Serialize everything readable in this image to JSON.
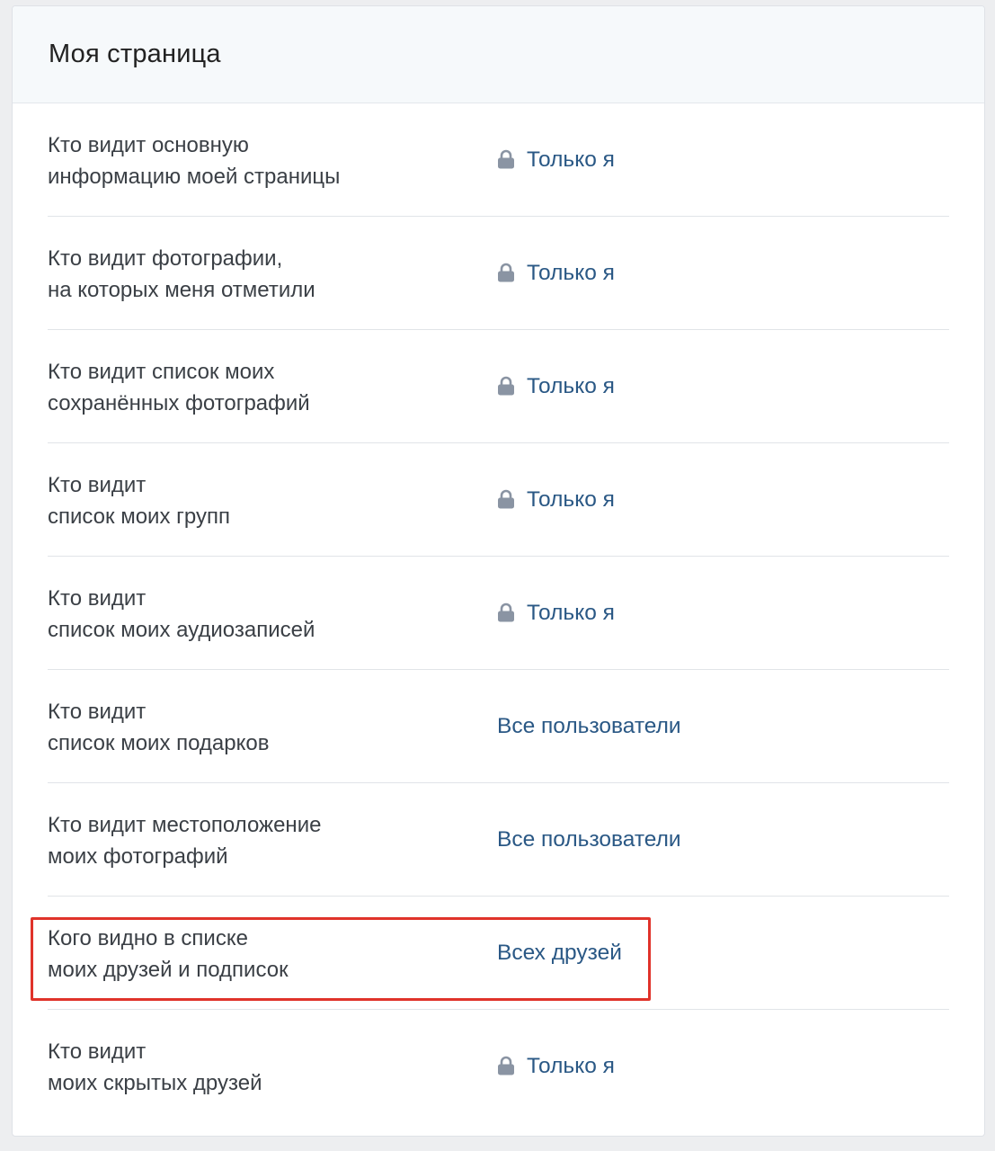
{
  "page": {
    "title": "Моя страница"
  },
  "colors": {
    "link": "#2a5885",
    "label": "#3a3f45",
    "highlight": "#e0332a",
    "lock": "#8a94a3"
  },
  "settings": [
    {
      "label": "Кто видит основную\nинформацию моей страницы",
      "value": "Только я",
      "locked": true
    },
    {
      "label": "Кто видит фотографии,\nна которых меня отметили",
      "value": "Только я",
      "locked": true
    },
    {
      "label": "Кто видит список моих\nсохранённых фотографий",
      "value": "Только я",
      "locked": true
    },
    {
      "label": "Кто видит\nсписок моих групп",
      "value": "Только я",
      "locked": true
    },
    {
      "label": "Кто видит\nсписок моих аудиозаписей",
      "value": "Только я",
      "locked": true
    },
    {
      "label": "Кто видит\nсписок моих подарков",
      "value": "Все пользователи",
      "locked": false
    },
    {
      "label": "Кто видит местоположение\nмоих фотографий",
      "value": "Все пользователи",
      "locked": false
    },
    {
      "label": "Кого видно в списке\nмоих друзей и подписок",
      "value": "Всех друзей",
      "locked": false,
      "highlighted": true
    },
    {
      "label": "Кто видит\nмоих скрытых друзей",
      "value": "Только я",
      "locked": true
    }
  ]
}
